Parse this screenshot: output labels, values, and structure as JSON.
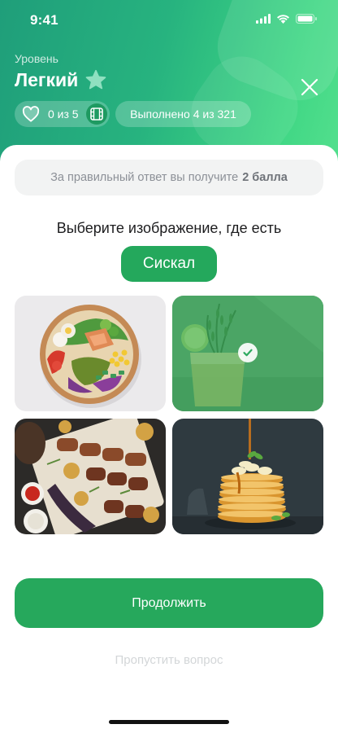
{
  "status_bar": {
    "time": "9:41",
    "icons": [
      "signal-icon",
      "wifi-icon",
      "battery-icon"
    ]
  },
  "header": {
    "level_caption": "Уровень",
    "level_name": "Легкий",
    "level_icon": "star-icon",
    "close_icon": "close-icon",
    "lives_icon": "heart-icon",
    "lives_text": "0 из 5",
    "video_icon": "film-icon",
    "progress_text": "Выполнено 4 из 321",
    "gradient_start": "#1f9e7a",
    "gradient_end": "#55e08e"
  },
  "reward": {
    "text": "За правильный ответ вы получите",
    "points": "2 балла"
  },
  "question": {
    "prompt": "Выберите изображение, где есть",
    "target_word": "Сискал"
  },
  "options": [
    {
      "image": "salad-bowl",
      "selected": false
    },
    {
      "image": "rosemary-lemon-drink",
      "selected": true
    },
    {
      "image": "grilled-kebabs",
      "selected": false
    },
    {
      "image": "pancake-stack",
      "selected": false
    }
  ],
  "actions": {
    "continue_label": "Продолжить",
    "skip_label": "Пропустить вопрос"
  },
  "colors": {
    "accent": "#26a85c",
    "selection_overlay": "#2eaa5f",
    "muted_text": "#8c9097",
    "skip_text": "#d3d6d8"
  }
}
